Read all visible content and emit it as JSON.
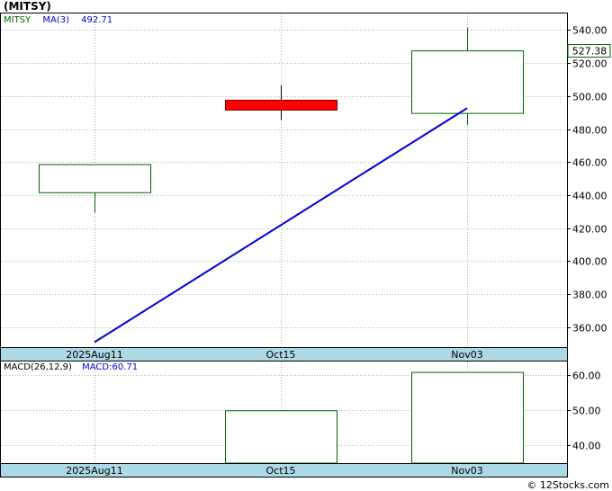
{
  "title": "(MITSY)",
  "credit": "© 12Stocks.com",
  "colors": {
    "background": "#ffffff",
    "grid": "#b0b0b0",
    "axis_band": "#add8e6",
    "up_candle": "#006400",
    "down_candle": "#ff0000",
    "ma_line": "#0000dd",
    "legend_symbol": "#006400",
    "legend_ma": "#0000cc",
    "price_tag": "#006400",
    "macd_bar": "#006400"
  },
  "chart_data": [
    {
      "type": "candlestick",
      "legend": {
        "symbol": "MITSY",
        "ma_label": "MA(3)",
        "ma_value": "492.71"
      },
      "last_price_label": "527.38",
      "x_tick_labels": [
        "2025Aug11",
        "Oct15",
        "Nov03"
      ],
      "y_ticks": [
        "360.00",
        "380.00",
        "400.00",
        "420.00",
        "440.00",
        "460.00",
        "480.00",
        "500.00",
        "520.00",
        "540.00"
      ],
      "ylim": [
        348,
        550
      ],
      "grid": true,
      "candles": [
        {
          "date": "2025Aug11",
          "open": 441.5,
          "high": 458.5,
          "low": 429.5,
          "close": 458.5,
          "direction": "up"
        },
        {
          "date": "Oct15",
          "open": 497.5,
          "high": 506.5,
          "low": 485.5,
          "close": 491.5,
          "direction": "down"
        },
        {
          "date": "Nov03",
          "open": 489.5,
          "high": 541.5,
          "low": 482.5,
          "close": 527.38,
          "direction": "up"
        }
      ],
      "moving_average": {
        "name": "MA(3)",
        "points": [
          {
            "date": "2025Aug11",
            "value": 351.0
          },
          {
            "date": "Nov03",
            "value": 492.71
          }
        ]
      }
    },
    {
      "type": "bar",
      "legend": {
        "label": "MACD(26,12,9)",
        "macd_label": "MACD:60.71"
      },
      "x_tick_labels": [
        "2025Aug11",
        "Oct15",
        "Nov03"
      ],
      "y_ticks": [
        "40.00",
        "50.00",
        "60.00"
      ],
      "ylim": [
        34.9,
        63.8
      ],
      "grid": true,
      "categories": [
        "Oct15",
        "Nov03"
      ],
      "values": [
        49.8,
        60.71
      ]
    }
  ]
}
